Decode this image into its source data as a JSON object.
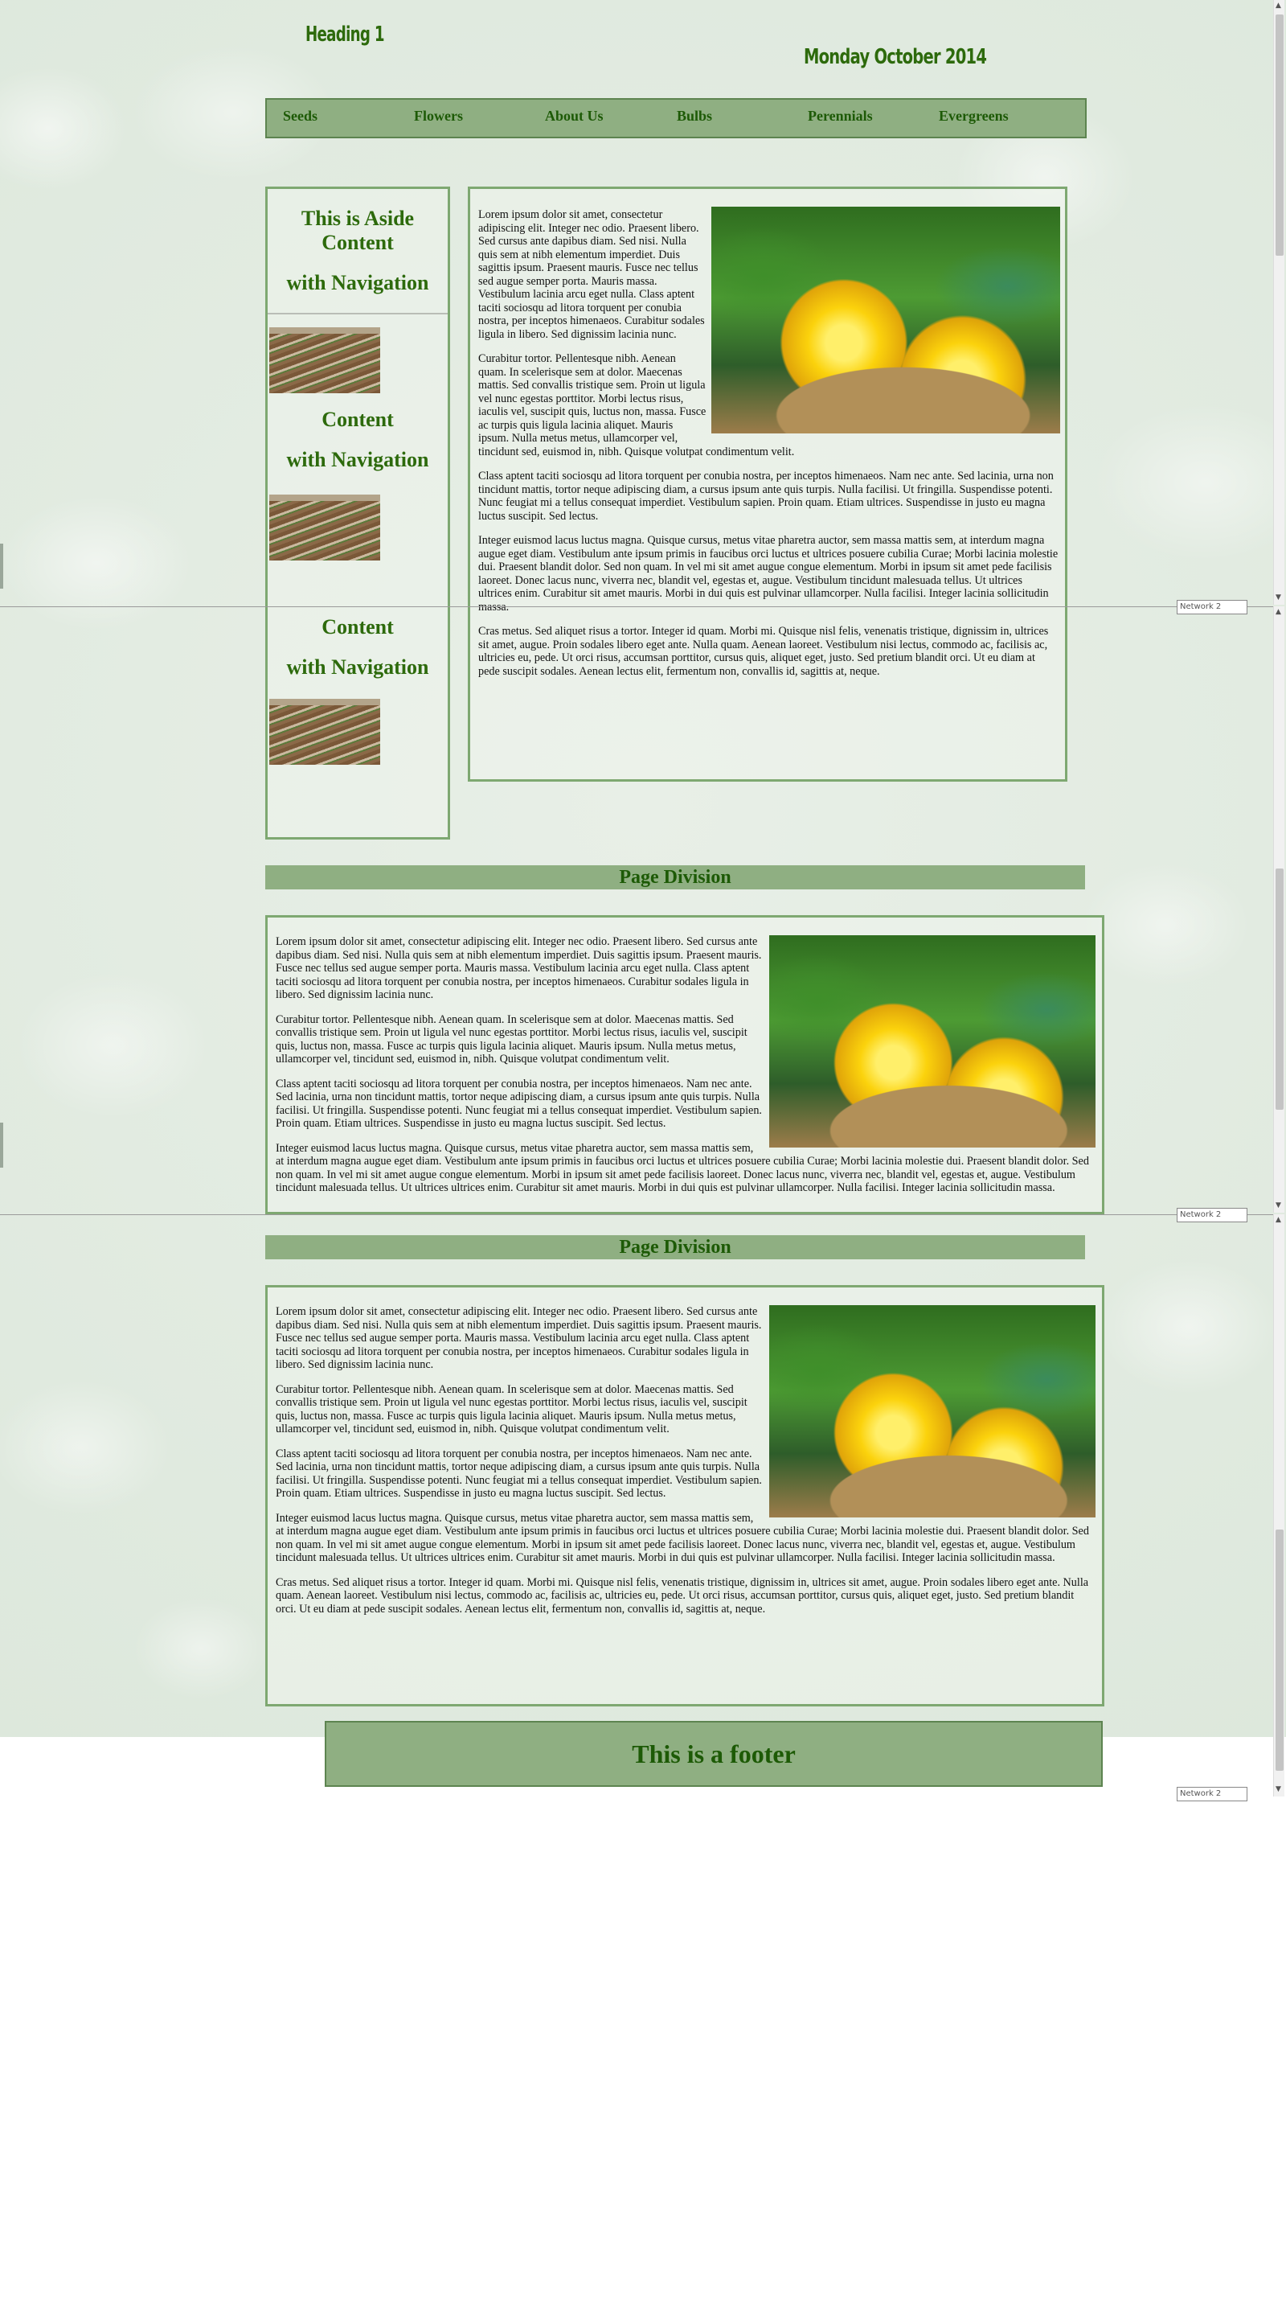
{
  "header": {
    "heading": "Heading 1",
    "date": "Monday October  2014"
  },
  "nav": {
    "items": [
      "Seeds",
      "Flowers",
      "About Us",
      "Bulbs",
      "Perennials",
      "Evergreens"
    ]
  },
  "aside": {
    "title_line1": "This is Aside",
    "title_line2": "Content",
    "title_line3": "with Navigation",
    "block2_line1": "Content",
    "block2_line2": "with Navigation",
    "block3_line1": "Content",
    "block3_line2": "with Navigation"
  },
  "article": {
    "p1": "Lorem ipsum dolor sit amet, consectetur adipiscing elit. Integer nec odio. Praesent libero. Sed cursus ante dapibus diam. Sed nisi. Nulla quis sem at nibh elementum imperdiet. Duis sagittis ipsum. Praesent mauris. Fusce nec tellus sed augue semper porta. Mauris massa. Vestibulum lacinia arcu eget nulla. Class aptent taciti sociosqu ad litora torquent per conubia nostra, per inceptos himenaeos. Curabitur sodales ligula in libero. Sed dignissim lacinia nunc.",
    "p2": "Curabitur tortor. Pellentesque nibh. Aenean quam. In scelerisque sem at dolor. Maecenas mattis. Sed convallis tristique sem. Proin ut ligula vel nunc egestas porttitor. Morbi lectus risus, iaculis vel, suscipit quis, luctus non, massa. Fusce ac turpis quis ligula lacinia aliquet. Mauris ipsum. Nulla metus metus, ullamcorper vel, tincidunt sed, euismod in, nibh. Quisque volutpat condimentum velit.",
    "p3": "Class aptent taciti sociosqu ad litora torquent per conubia nostra, per inceptos himenaeos. Nam nec ante. Sed lacinia, urna non tincidunt mattis, tortor neque adipiscing diam, a cursus ipsum ante quis turpis. Nulla facilisi. Ut fringilla. Suspendisse potenti. Nunc feugiat mi a tellus consequat imperdiet. Vestibulum sapien. Proin quam. Etiam ultrices. Suspendisse in justo eu magna luctus suscipit. Sed lectus.",
    "p4": "Integer euismod lacus luctus magna. Quisque cursus, metus vitae pharetra auctor, sem massa mattis sem, at interdum magna augue eget diam. Vestibulum ante ipsum primis in faucibus orci luctus et ultrices posuere cubilia Curae; Morbi lacinia molestie dui. Praesent blandit dolor. Sed non quam. In vel mi sit amet augue congue elementum. Morbi in ipsum sit amet pede facilisis laoreet. Donec lacus nunc, viverra nec, blandit vel, egestas et, augue. Vestibulum tincidunt malesuada tellus. Ut ultrices ultrices enim. Curabitur sit amet mauris. Morbi in dui quis est pulvinar ullamcorper. Nulla facilisi. Integer lacinia sollicitudin massa.",
    "p5": "Cras metus. Sed aliquet risus a tortor. Integer id quam. Morbi mi. Quisque nisl felis, venenatis tristique, dignissim in, ultrices sit amet, augue. Proin sodales libero eget ante. Nulla quam. Aenean laoreet. Vestibulum nisi lectus, commodo ac, facilisis ac, ultricies eu, pede. Ut orci risus, accumsan porttitor, cursus quis, aliquet eget, justo. Sed pretium blandit orci. Ut eu diam at pede suscipit sodales. Aenean lectus elit, fermentum non, convallis id, sagittis at, neque."
  },
  "page_division": {
    "title": "Page Division"
  },
  "footer": {
    "text": "This is a footer"
  },
  "widgets": {
    "mini_box_text": "Network 2"
  }
}
